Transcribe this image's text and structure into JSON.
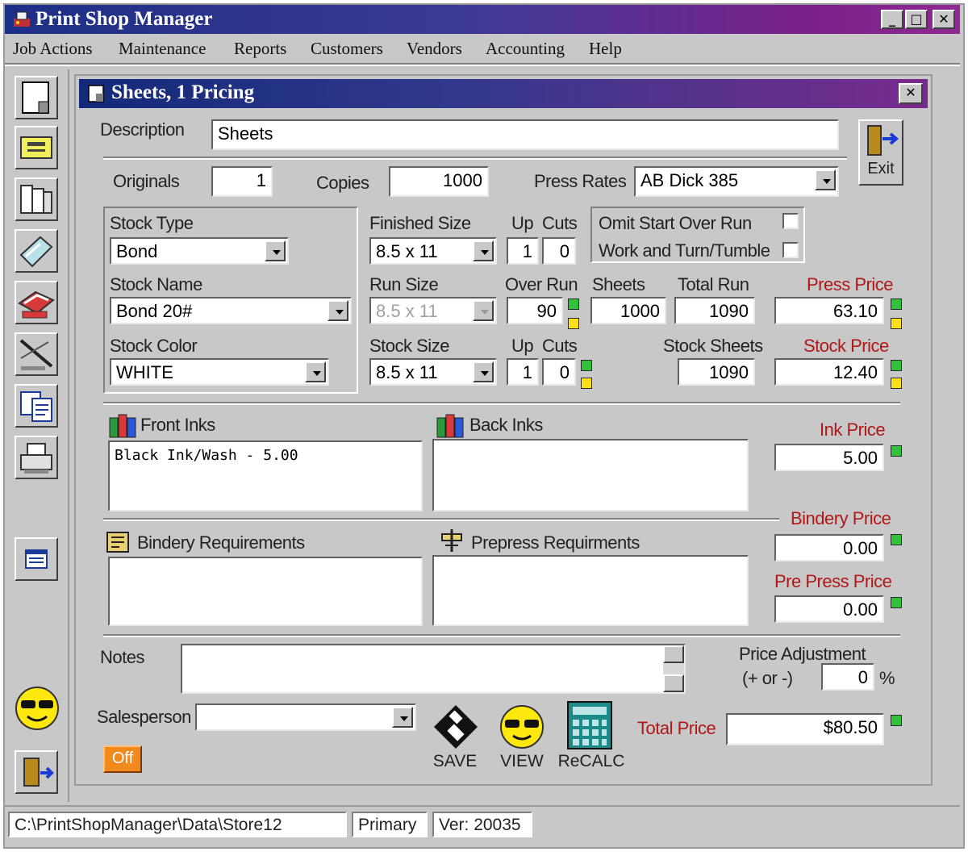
{
  "window": {
    "title": "Print Shop Manager"
  },
  "menu": [
    "Job Actions",
    "Maintenance",
    "Reports",
    "Customers",
    "Vendors",
    "Accounting",
    "Help"
  ],
  "toolbar": {
    "icons": [
      "new-job-icon",
      "job-ticket-icon",
      "files-icon",
      "estimate-icon",
      "printer-icon",
      "pen-icon",
      "copy-icon",
      "fax-icon",
      "calendar-icon"
    ],
    "salesperson_icon": "sunglasses-face-icon",
    "exit_icon": "exit-door-icon"
  },
  "form": {
    "title": "Sheets, 1 Pricing",
    "description": {
      "label": "Description",
      "value": "Sheets"
    },
    "exit_label": "Exit",
    "originals": {
      "label": "Originals",
      "value": "1"
    },
    "copies": {
      "label": "Copies",
      "value": "1000"
    },
    "press_rates": {
      "label": "Press Rates",
      "value": "AB Dick 385"
    },
    "stock_type": {
      "label": "Stock Type",
      "value": "Bond"
    },
    "stock_name": {
      "label": "Stock Name",
      "value": "Bond 20#"
    },
    "stock_color": {
      "label": "Stock Color",
      "value": "WHITE"
    },
    "finished_size": {
      "label": "Finished Size",
      "value": "8.5 x 11"
    },
    "up_label": "Up",
    "cuts_label": "Cuts",
    "finished_up": "1",
    "finished_cuts": "0",
    "omit_start_over_run": {
      "label": "Omit Start Over Run",
      "checked": false
    },
    "work_and_turn": {
      "label": "Work and Turn/Tumble",
      "checked": false
    },
    "run_size": {
      "label": "Run Size",
      "value": "8.5 x 11"
    },
    "over_run": {
      "label": "Over Run",
      "value": "90"
    },
    "sheets": {
      "label": "Sheets",
      "value": "1000"
    },
    "total_run": {
      "label": "Total Run",
      "value": "1090"
    },
    "press_price": {
      "label": "Press Price",
      "value": "63.10"
    },
    "stock_size": {
      "label": "Stock Size",
      "value": "8.5 x 11"
    },
    "stock_up": "1",
    "stock_cuts": "0",
    "stock_sheets": {
      "label": "Stock Sheets",
      "value": "1090"
    },
    "stock_price": {
      "label": "Stock Price",
      "value": "12.40"
    },
    "front_inks": {
      "label": "Front Inks",
      "value": "Black Ink/Wash - 5.00"
    },
    "back_inks": {
      "label": "Back Inks",
      "value": ""
    },
    "ink_price": {
      "label": "Ink Price",
      "value": "5.00"
    },
    "bindery_requirements": {
      "label": "Bindery Requirements",
      "value": ""
    },
    "prepress_requirements": {
      "label": "Prepress Requirments",
      "value": ""
    },
    "bindery_price": {
      "label": "Bindery Price",
      "value": "0.00"
    },
    "prepress_price": {
      "label": "Pre Press Price",
      "value": "0.00"
    },
    "notes": {
      "label": "Notes",
      "value": ""
    },
    "price_adjustment": {
      "label": "Price Adjustment",
      "sublabel": "(+ or -)",
      "value": "0",
      "unit": "%"
    },
    "salesperson": {
      "label": "Salesperson",
      "value": ""
    },
    "off_label": "Off",
    "save_label": "SAVE",
    "view_label": "VIEW",
    "recalc_label": "ReCALC",
    "total_price": {
      "label": "Total Price",
      "value": "$80.50"
    }
  },
  "status": {
    "path": "C:\\PrintShopManager\\Data\\Store12",
    "mode": "Primary",
    "version": "Ver: 20035"
  },
  "colors": {
    "title_start": "#1c2f86",
    "title_end": "#8e2a92",
    "price_label": "#b01818",
    "indicator_green": "#2fc23a",
    "indicator_yellow": "#ffe018",
    "off_button": "#f08a1c"
  }
}
